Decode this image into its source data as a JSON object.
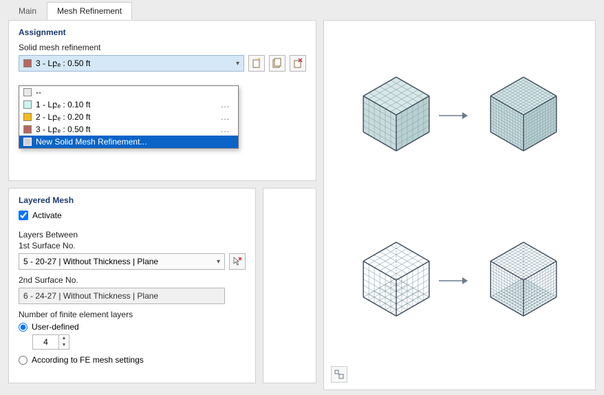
{
  "tabs": {
    "main": "Main",
    "mesh": "Mesh Refinement"
  },
  "assignment": {
    "title": "Assignment",
    "label": "Solid mesh refinement",
    "selected": "3 - Lբₑ : 0.50 ft",
    "selected_color": "#b86660",
    "options": [
      {
        "color": "#e8e8e8",
        "label": "--",
        "dots": ""
      },
      {
        "color": "#c9f5ed",
        "label": "1 - Lբₑ : 0.10 ft",
        "dots": "..."
      },
      {
        "color": "#f2ba1b",
        "label": "2 - Lբₑ : 0.20 ft",
        "dots": "..."
      },
      {
        "color": "#b86660",
        "label": "3 - Lբₑ : 0.50 ft",
        "dots": "..."
      },
      {
        "color": "#d0d0d0",
        "label": "New Solid Mesh Refinement...",
        "dots": "",
        "highlight": true
      }
    ]
  },
  "layered": {
    "title": "Layered Mesh",
    "activate": "Activate",
    "between": "Layers Between",
    "first": "1st Surface No.",
    "first_val": "5 - 20-27 | Without Thickness | Plane",
    "second": "2nd Surface No.",
    "second_val": "6 - 24-27 | Without Thickness | Plane",
    "num_layers": "Number of finite element layers",
    "user_defined": "User-defined",
    "user_val": "4",
    "according": "According to FE mesh settings"
  }
}
